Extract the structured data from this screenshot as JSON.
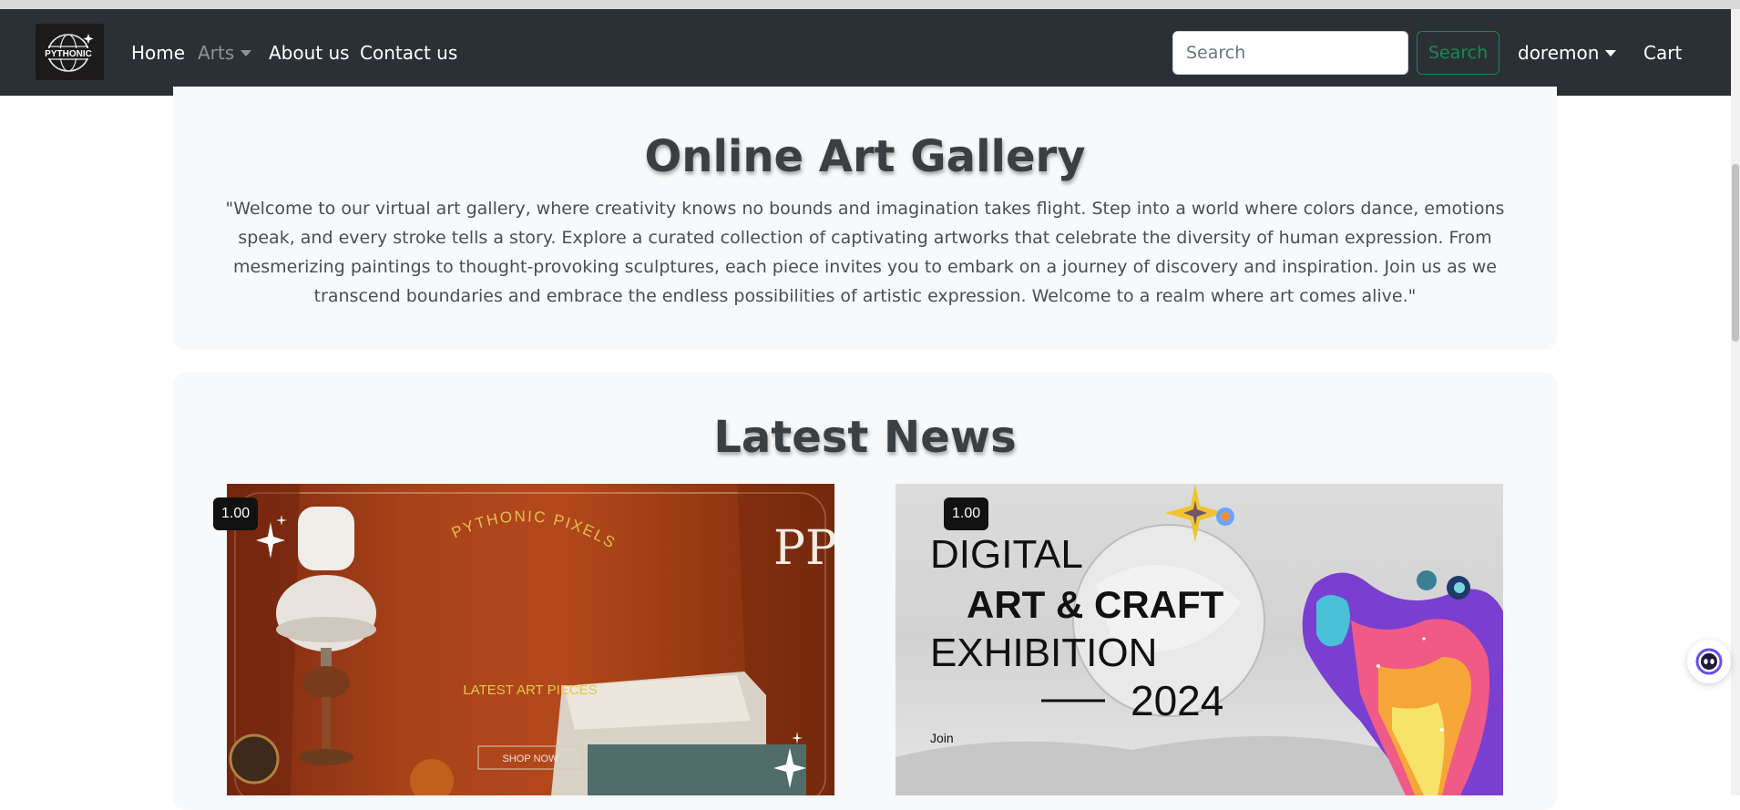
{
  "navbar": {
    "logo_text": "PYTHONIC",
    "links": {
      "home": "Home",
      "arts": "Arts",
      "about": "About us",
      "contact": "Contact us"
    },
    "search": {
      "placeholder": "Search",
      "value": "",
      "button_label": "Search"
    },
    "user_label": "doremon",
    "cart_label": "Cart"
  },
  "hero": {
    "title": "Online Art Gallery",
    "description": "\"Welcome to our virtual art gallery, where creativity knows no bounds and imagination takes flight. Step into a world where colors dance, emotions speak, and every stroke tells a story. Explore a curated collection of captivating artworks that celebrate the diversity of human expression. From mesmerizing paintings to thought-provoking sculptures, each piece invites you to embark on a journey of discovery and inspiration. Join us as we transcend boundaries and embrace the endless possibilities of artistic expression. Welcome to a realm where art comes alive.\""
  },
  "news": {
    "title": "Latest News",
    "cards": [
      {
        "badge": "1.00",
        "arc_text": "PYTHONIC PIXELS",
        "monogram": "PP",
        "caption": "LATEST ART PIECES",
        "button": "SHOP NOW"
      },
      {
        "badge": "1.00",
        "line1": "DIGITAL",
        "line2": "ART & CRAFT",
        "line3": "EXHIBITION",
        "year": "2024",
        "join": "Join"
      }
    ]
  },
  "colors": {
    "navbar_bg": "#2b3035",
    "search_accent": "#198754",
    "panel_bg": "#f8f9fa",
    "heading": "#3a3f44"
  }
}
